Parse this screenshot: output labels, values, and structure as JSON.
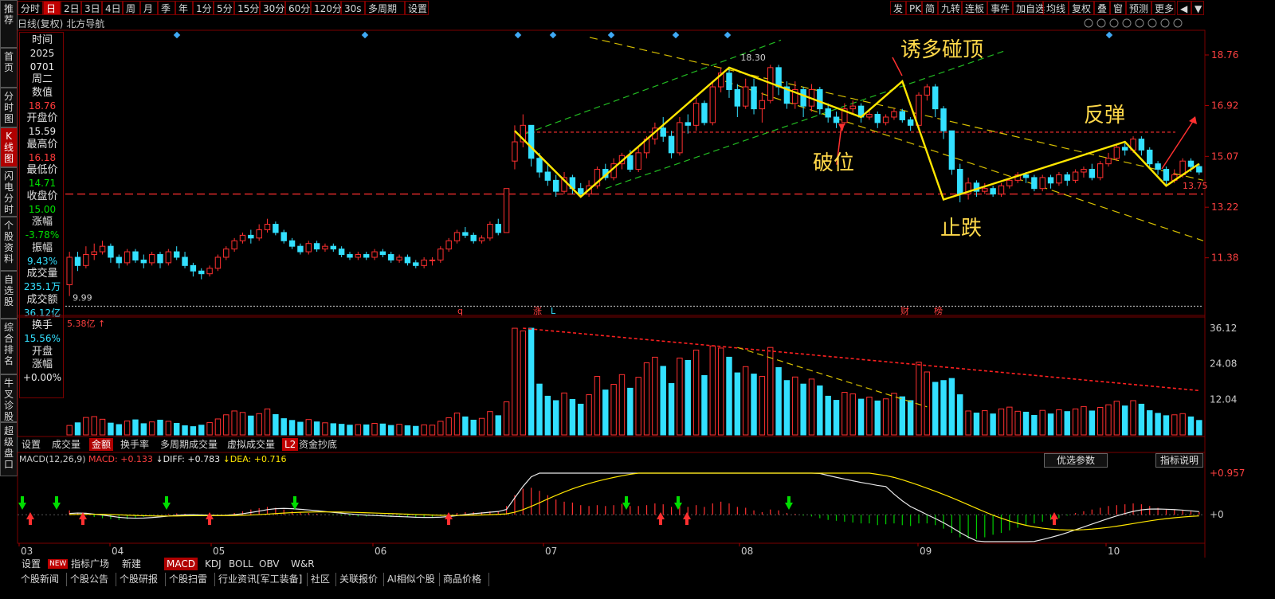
{
  "toolbar": {
    "period_left": [
      "分时",
      "日",
      "2日",
      "3日",
      "4日",
      "周",
      "月",
      "季",
      "年",
      "1分",
      "5分",
      "15分",
      "30分",
      "60分",
      "120分",
      "30s",
      "多周期",
      "设置"
    ],
    "active_period": "日",
    "right_buttons": [
      "发",
      "PK",
      "简",
      "九转",
      "连板",
      "事件",
      "加自选",
      "均线",
      "复权",
      "叠",
      "窗",
      "预测",
      "更多"
    ]
  },
  "sidebar": [
    "推荐",
    "首页",
    "分时图",
    "K线图",
    "闪电分时",
    "个股资料",
    "自选股",
    "综合排名",
    "牛叉诊股",
    "超级盘口"
  ],
  "stock": {
    "chart_label": "日线(复权)",
    "name": "北方导航"
  },
  "info": {
    "items": [
      {
        "label": "时间",
        "values": [
          "2025",
          "0701"
        ],
        "color": "white"
      },
      {
        "label": "",
        "values": [
          "周二"
        ],
        "color": "lab"
      },
      {
        "label": "数值",
        "values": [
          "18.76"
        ],
        "color": "red"
      },
      {
        "label": "开盘价",
        "values": [
          "15.59"
        ],
        "color": "white"
      },
      {
        "label": "最高价",
        "values": [
          "16.18"
        ],
        "color": "red"
      },
      {
        "label": "最低价",
        "values": [
          "14.71"
        ],
        "color": "green"
      },
      {
        "label": "收盘价",
        "values": [
          "15.00"
        ],
        "color": "green"
      },
      {
        "label": "涨幅",
        "values": [
          "-3.78%"
        ],
        "color": "green"
      },
      {
        "label": "振幅",
        "values": [
          "9.43%"
        ],
        "color": "cyan"
      },
      {
        "label": "成交量",
        "values": [
          "235.1万"
        ],
        "color": "cyan"
      },
      {
        "label": "成交额",
        "values": [
          "36.12亿"
        ],
        "color": "cyan"
      },
      {
        "label": "换手",
        "values": [
          "15.56%"
        ],
        "color": "cyan"
      },
      {
        "label": "开盘",
        "values": [],
        "color": "white"
      },
      {
        "label": "涨幅",
        "values": [
          "+0.00%"
        ],
        "color": "white"
      }
    ]
  },
  "price_axis": [
    "18.76",
    "16.92",
    "15.07",
    "13.22",
    "11.38"
  ],
  "price_markers": {
    "high": "18.30",
    "low": "9.99",
    "last": "13.75"
  },
  "event_markers": [
    "q",
    "涨",
    "L",
    "财",
    "榜"
  ],
  "volume": {
    "label": "5.38亿",
    "arrow": "↑",
    "axis": [
      "36.12",
      "24.08",
      "12.04"
    ]
  },
  "volume_tabs": [
    "设置",
    "成交量",
    "金额",
    "换手率",
    "多周期成交量",
    "虚拟成交量",
    "L2",
    "资金抄底"
  ],
  "volume_active_tab": "金额",
  "macd": {
    "name": "MACD(12,26,9)",
    "macd_label": "MACD: +0.133",
    "diff_label": "DIFF: +0.783",
    "dea_label": "DEA: +0.716",
    "axis_top": "+0.957",
    "axis_zero": "+0",
    "params_button": "优选参数",
    "help_button": "指标说明"
  },
  "months": [
    "03",
    "04",
    "05",
    "06",
    "07",
    "08",
    "09",
    "10"
  ],
  "indicator_tabs": [
    "设置",
    "指标广场",
    "新建",
    "MACD",
    "KDJ",
    "BOLL",
    "OBV",
    "W&R"
  ],
  "indicator_new_badge": "NEW",
  "indicator_active": "MACD",
  "news_tabs": [
    "个股新闻",
    "个股公告",
    "个股研报",
    "个股扫雷",
    "行业资讯[军工装备]",
    "社区",
    "关联报价",
    "AI相似个股",
    "商品价格"
  ],
  "annotations": [
    "诱多碰顶",
    "破位",
    "反弹",
    "止跌"
  ],
  "colors": {
    "up": "#ff3030",
    "down": "#33e0ff",
    "trend": "#ffe600",
    "channel_green": "#22bb22",
    "dash_yellow": "#d8c000"
  },
  "chart_data": {
    "type": "candlestick",
    "title": "北方导航 日线(复权)",
    "y_range": [
      9.4,
      19.6
    ],
    "candles": [
      [
        10.4,
        11.4,
        11.6,
        9.99
      ],
      [
        11.4,
        11.1,
        11.6,
        10.9
      ],
      [
        11.1,
        11.5,
        11.8,
        11.0
      ],
      [
        11.5,
        11.6,
        11.9,
        11.3
      ],
      [
        11.6,
        11.8,
        12.0,
        11.5
      ],
      [
        11.8,
        11.4,
        11.9,
        11.2
      ],
      [
        11.4,
        11.2,
        11.5,
        11.0
      ],
      [
        11.2,
        11.6,
        11.7,
        11.1
      ],
      [
        11.6,
        11.3,
        11.7,
        11.2
      ],
      [
        11.3,
        11.2,
        11.5,
        11.0
      ],
      [
        11.2,
        11.5,
        11.6,
        11.1
      ],
      [
        11.5,
        11.2,
        11.6,
        11.0
      ],
      [
        11.2,
        11.6,
        11.7,
        11.1
      ],
      [
        11.6,
        11.4,
        11.8,
        11.3
      ],
      [
        11.4,
        11.1,
        11.6,
        11.0
      ],
      [
        11.1,
        10.9,
        11.2,
        10.7
      ],
      [
        10.9,
        10.8,
        11.0,
        10.6
      ],
      [
        10.8,
        11.0,
        11.1,
        10.7
      ],
      [
        11.0,
        11.4,
        11.5,
        10.9
      ],
      [
        11.4,
        11.7,
        11.8,
        11.3
      ],
      [
        11.7,
        12.0,
        12.1,
        11.6
      ],
      [
        12.0,
        12.2,
        12.3,
        11.9
      ],
      [
        12.2,
        12.1,
        12.4,
        11.9
      ],
      [
        12.1,
        12.4,
        12.6,
        12.0
      ],
      [
        12.4,
        12.6,
        12.8,
        12.3
      ],
      [
        12.6,
        12.3,
        12.7,
        12.2
      ],
      [
        12.3,
        12.0,
        12.4,
        11.9
      ],
      [
        12.0,
        11.8,
        12.1,
        11.7
      ],
      [
        11.8,
        11.6,
        11.9,
        11.5
      ],
      [
        11.6,
        11.9,
        12.0,
        11.5
      ],
      [
        11.9,
        11.7,
        12.0,
        11.6
      ],
      [
        11.7,
        11.8,
        11.9,
        11.6
      ],
      [
        11.8,
        11.7,
        11.9,
        11.6
      ],
      [
        11.7,
        11.5,
        11.8,
        11.4
      ],
      [
        11.5,
        11.4,
        11.6,
        11.3
      ],
      [
        11.4,
        11.5,
        11.6,
        11.3
      ],
      [
        11.5,
        11.4,
        11.6,
        11.3
      ],
      [
        11.4,
        11.6,
        11.7,
        11.3
      ],
      [
        11.6,
        11.5,
        11.7,
        11.4
      ],
      [
        11.5,
        11.3,
        11.6,
        11.2
      ],
      [
        11.3,
        11.4,
        11.5,
        11.2
      ],
      [
        11.4,
        11.2,
        11.5,
        11.1
      ],
      [
        11.2,
        11.1,
        11.3,
        11.0
      ],
      [
        11.1,
        11.3,
        11.4,
        11.0
      ],
      [
        11.3,
        11.3,
        11.4,
        11.1
      ],
      [
        11.3,
        11.7,
        11.8,
        11.2
      ],
      [
        11.7,
        12.0,
        12.1,
        11.6
      ],
      [
        12.0,
        12.3,
        12.4,
        11.9
      ],
      [
        12.3,
        12.2,
        12.5,
        12.1
      ],
      [
        12.2,
        12.0,
        12.3,
        11.9
      ],
      [
        12.0,
        12.1,
        12.2,
        11.9
      ],
      [
        12.1,
        12.6,
        12.7,
        12.0
      ],
      [
        12.6,
        12.3,
        12.8,
        12.2
      ],
      [
        12.3,
        13.9,
        13.9,
        12.3
      ],
      [
        14.9,
        15.6,
        16.2,
        14.6
      ],
      [
        15.6,
        16.2,
        16.6,
        15.4
      ],
      [
        16.2,
        15.0,
        16.2,
        14.7
      ],
      [
        15.0,
        14.5,
        15.2,
        14.3
      ],
      [
        14.5,
        14.2,
        14.8,
        14.0
      ],
      [
        14.2,
        13.8,
        14.4,
        13.6
      ],
      [
        13.8,
        14.3,
        14.5,
        13.7
      ],
      [
        14.3,
        13.9,
        14.4,
        13.7
      ],
      [
        13.9,
        13.7,
        14.1,
        13.6
      ],
      [
        13.7,
        14.0,
        14.2,
        13.6
      ],
      [
        14.0,
        14.6,
        14.7,
        13.9
      ],
      [
        14.6,
        14.3,
        14.8,
        14.2
      ],
      [
        14.3,
        14.8,
        15.0,
        14.2
      ],
      [
        14.8,
        15.1,
        15.2,
        14.6
      ],
      [
        15.1,
        14.6,
        15.3,
        14.5
      ],
      [
        14.6,
        15.2,
        15.4,
        14.5
      ],
      [
        15.2,
        15.7,
        15.8,
        15.0
      ],
      [
        15.7,
        16.1,
        16.3,
        15.5
      ],
      [
        16.1,
        15.8,
        16.5,
        15.6
      ],
      [
        15.8,
        15.2,
        16.0,
        15.0
      ],
      [
        15.2,
        16.3,
        16.5,
        15.1
      ],
      [
        16.3,
        16.2,
        16.6,
        15.9
      ],
      [
        16.2,
        17.0,
        17.2,
        16.0
      ],
      [
        17.0,
        16.3,
        17.1,
        16.2
      ],
      [
        16.3,
        17.6,
        17.8,
        16.2
      ],
      [
        17.6,
        18.1,
        18.3,
        17.4
      ],
      [
        18.1,
        17.5,
        18.3,
        17.2
      ],
      [
        17.5,
        16.9,
        17.7,
        16.5
      ],
      [
        16.9,
        17.6,
        17.9,
        16.8
      ],
      [
        17.6,
        16.8,
        17.9,
        16.6
      ],
      [
        16.8,
        17.1,
        17.4,
        16.3
      ],
      [
        17.1,
        18.3,
        18.4,
        17.0
      ],
      [
        18.3,
        17.6,
        18.4,
        17.3
      ],
      [
        17.6,
        17.0,
        17.8,
        16.8
      ],
      [
        17.0,
        17.5,
        17.8,
        16.8
      ],
      [
        17.5,
        16.9,
        17.6,
        16.5
      ],
      [
        16.9,
        17.5,
        17.7,
        16.7
      ],
      [
        17.5,
        16.8,
        17.6,
        16.6
      ],
      [
        16.8,
        16.5,
        17.0,
        16.3
      ],
      [
        16.5,
        16.3,
        16.7,
        16.1
      ],
      [
        16.3,
        16.8,
        17.0,
        16.2
      ],
      [
        16.8,
        16.9,
        17.1,
        16.6
      ],
      [
        16.9,
        16.5,
        17.0,
        16.3
      ],
      [
        16.5,
        16.6,
        16.8,
        16.4
      ],
      [
        16.6,
        16.3,
        16.7,
        16.1
      ],
      [
        16.3,
        16.5,
        16.6,
        16.2
      ],
      [
        16.5,
        16.7,
        16.8,
        16.4
      ],
      [
        16.7,
        16.4,
        16.8,
        16.3
      ],
      [
        16.4,
        16.2,
        16.5,
        16.0
      ],
      [
        16.2,
        17.3,
        17.4,
        16.1
      ],
      [
        17.3,
        17.6,
        17.7,
        17.1
      ],
      [
        17.6,
        16.8,
        17.7,
        16.5
      ],
      [
        16.8,
        16.0,
        16.9,
        15.7
      ],
      [
        16.0,
        14.6,
        16.0,
        14.4
      ],
      [
        14.6,
        13.7,
        14.8,
        13.4
      ],
      [
        13.7,
        14.1,
        14.3,
        13.5
      ],
      [
        14.1,
        13.8,
        14.2,
        13.6
      ],
      [
        13.8,
        13.9,
        14.1,
        13.7
      ],
      [
        13.9,
        13.7,
        14.0,
        13.6
      ],
      [
        13.7,
        14.0,
        14.1,
        13.6
      ],
      [
        14.0,
        14.2,
        14.3,
        13.9
      ],
      [
        14.2,
        14.4,
        14.5,
        14.1
      ],
      [
        14.4,
        14.3,
        14.5,
        14.1
      ],
      [
        14.3,
        13.9,
        14.4,
        13.8
      ],
      [
        13.9,
        14.3,
        14.4,
        13.8
      ],
      [
        14.3,
        14.1,
        14.4,
        13.9
      ],
      [
        14.1,
        14.4,
        14.5,
        14.0
      ],
      [
        14.4,
        14.2,
        14.5,
        14.0
      ],
      [
        14.2,
        14.5,
        14.6,
        14.1
      ],
      [
        14.5,
        14.6,
        14.7,
        14.3
      ],
      [
        14.6,
        14.3,
        14.8,
        14.2
      ],
      [
        14.3,
        14.8,
        14.9,
        14.2
      ],
      [
        14.8,
        15.0,
        15.2,
        14.7
      ],
      [
        15.0,
        15.4,
        15.5,
        14.9
      ],
      [
        15.4,
        15.3,
        15.6,
        15.1
      ],
      [
        15.3,
        15.7,
        15.8,
        15.2
      ],
      [
        15.7,
        15.3,
        15.8,
        15.1
      ],
      [
        15.3,
        14.8,
        15.4,
        14.6
      ],
      [
        14.8,
        14.6,
        14.9,
        14.4
      ],
      [
        14.6,
        14.2,
        14.7,
        14.0
      ],
      [
        14.2,
        14.4,
        14.6,
        14.1
      ],
      [
        14.4,
        14.9,
        15.0,
        14.3
      ],
      [
        14.9,
        14.7,
        15.0,
        14.5
      ],
      [
        14.7,
        14.5,
        14.8,
        14.4
      ]
    ],
    "volume": [
      3.2,
      4.1,
      5.9,
      6.2,
      5.3,
      4.0,
      3.5,
      4.7,
      5.1,
      3.8,
      4.4,
      5.0,
      4.6,
      3.9,
      3.1,
      2.8,
      3.3,
      4.2,
      5.4,
      6.8,
      8.1,
      7.6,
      6.4,
      7.2,
      8.8,
      6.9,
      5.5,
      4.9,
      4.3,
      5.2,
      4.4,
      4.1,
      3.8,
      3.6,
      3.3,
      3.5,
      3.4,
      3.9,
      3.7,
      3.2,
      3.6,
      3.1,
      2.9,
      3.4,
      3.3,
      4.6,
      5.8,
      7.4,
      6.1,
      5.0,
      5.6,
      7.9,
      6.5,
      11.2,
      36.1,
      35.2,
      36.1,
      17.2,
      13.1,
      11.6,
      14.2,
      12.0,
      10.4,
      13.6,
      19.8,
      15.2,
      17.1,
      20.4,
      15.8,
      19.5,
      24.4,
      26.3,
      23.2,
      17.4,
      26.0,
      25.2,
      28.7,
      20.1,
      30.1,
      29.4,
      26.3,
      21.0,
      23.1,
      20.6,
      19.8,
      29.6,
      22.8,
      18.4,
      19.6,
      17.2,
      18.9,
      16.6,
      13.1,
      11.7,
      14.4,
      13.9,
      12.1,
      12.8,
      11.5,
      12.2,
      14.1,
      12.9,
      11.6,
      24.6,
      21.3,
      17.8,
      18.4,
      19.1,
      13.6,
      8.1,
      7.4,
      8.2,
      7.1,
      8.8,
      9.4,
      8.0,
      7.7,
      6.6,
      8.3,
      7.1,
      8.5,
      7.9,
      8.8,
      9.6,
      8.1,
      9.3,
      10.2,
      11.4,
      9.8,
      11.6,
      10.4,
      8.2,
      7.3,
      6.5,
      6.8,
      7.2,
      6.1,
      4.9
    ],
    "volume_unit": "亿",
    "macd_hist": [
      0.1,
      0.05,
      0.0,
      -0.05,
      -0.08,
      -0.1,
      -0.12,
      -0.1,
      -0.08,
      -0.05,
      -0.02,
      0.0,
      0.02,
      0.03,
      0.02,
      0.0,
      -0.02,
      -0.03,
      -0.02,
      0.0,
      0.04,
      0.08,
      0.12,
      0.15,
      0.18,
      0.16,
      0.12,
      0.08,
      0.05,
      0.04,
      0.02,
      0.0,
      -0.01,
      -0.02,
      -0.03,
      -0.04,
      -0.04,
      -0.03,
      -0.04,
      -0.05,
      -0.05,
      -0.06,
      -0.07,
      -0.06,
      -0.05,
      -0.03,
      0.0,
      0.04,
      0.06,
      0.06,
      0.06,
      0.08,
      0.08,
      0.2,
      0.45,
      0.6,
      0.62,
      0.55,
      0.45,
      0.35,
      0.3,
      0.28,
      0.22,
      0.2,
      0.22,
      0.2,
      0.22,
      0.25,
      0.2,
      0.2,
      0.22,
      0.26,
      0.24,
      0.18,
      0.2,
      0.18,
      0.22,
      0.18,
      0.26,
      0.3,
      0.26,
      0.18,
      0.16,
      0.1,
      0.06,
      0.12,
      0.1,
      0.04,
      0.02,
      -0.02,
      -0.04,
      -0.08,
      -0.12,
      -0.14,
      -0.16,
      -0.18,
      -0.2,
      -0.2,
      -0.24,
      -0.22,
      -0.2,
      -0.24,
      -0.26,
      -0.2,
      -0.2,
      -0.24,
      -0.32,
      -0.42,
      -0.52,
      -0.55,
      -0.56,
      -0.52,
      -0.46,
      -0.42,
      -0.36,
      -0.3,
      -0.25,
      -0.2,
      -0.16,
      -0.12,
      -0.08,
      -0.02,
      0.04,
      0.08,
      0.12,
      0.16,
      0.2,
      0.22,
      0.24,
      0.26,
      0.24,
      0.2,
      0.16,
      0.13,
      0.12,
      0.1,
      0.08,
      0.06
    ],
    "macd_y_range": [
      -0.62,
      0.957
    ],
    "series": [
      {
        "name": "DIFF",
        "color": "#e8e8e8"
      },
      {
        "name": "DEA",
        "color": "#ffe600"
      }
    ],
    "x_month_labels": [
      "03",
      "04",
      "05",
      "06",
      "07",
      "08",
      "09",
      "10"
    ]
  }
}
